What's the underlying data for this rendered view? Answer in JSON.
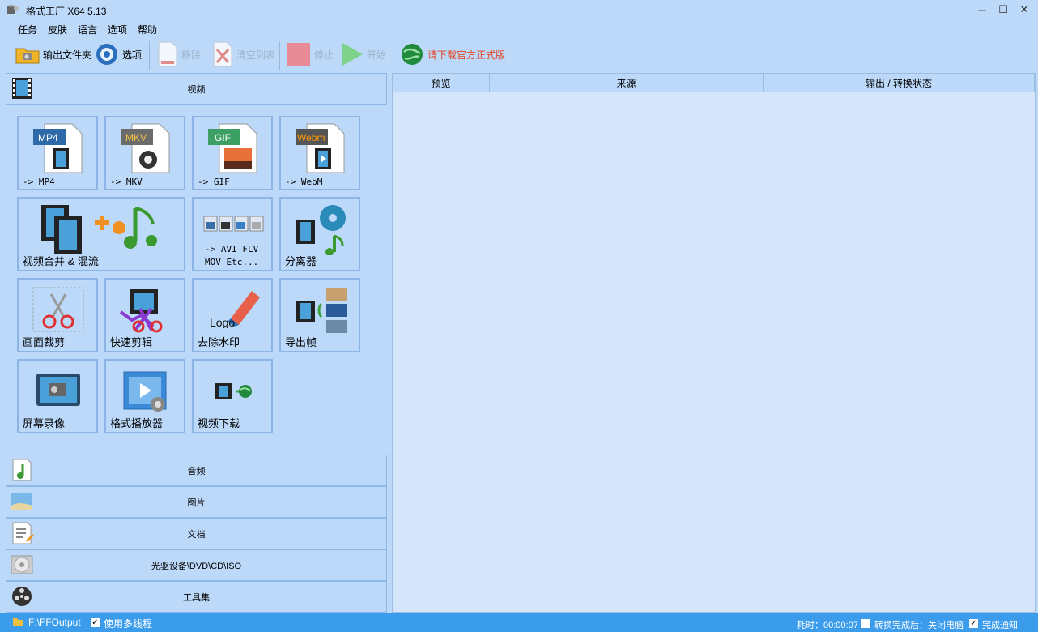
{
  "window": {
    "title": "格式工厂 X64 5.13",
    "minimize": "─",
    "maximize": "☐",
    "close": "✕"
  },
  "menu": {
    "items": [
      "任务",
      "皮肤",
      "语言",
      "选项",
      "帮助"
    ]
  },
  "toolbar": {
    "output_folder": "输出文件夹",
    "options": "选项",
    "remove": "移除",
    "clear_list": "清空列表",
    "stop": "停止",
    "start": "开始",
    "download": "请下载官方正式版"
  },
  "categories": {
    "video": "视频",
    "audio": "音频",
    "image": "图片",
    "document": "文档",
    "optical": "光驱设备\\DVD\\CD\\ISO",
    "tools": "工具集"
  },
  "tiles": {
    "mp4": {
      "badge": "MP4",
      "label": "-> MP4"
    },
    "mkv": {
      "badge": "MKV",
      "label": "-> MKV"
    },
    "gif": {
      "badge": "GIF",
      "label": "-> GIF"
    },
    "webm": {
      "badge": "Webm",
      "label": "-> WebM"
    },
    "merge": {
      "label": "视频合并 & 混流"
    },
    "avi": {
      "label1": "-> AVI FLV",
      "label2": "MOV Etc..."
    },
    "splitter": {
      "label": "分离器"
    },
    "crop": {
      "label": "画面裁剪"
    },
    "quick_clip": {
      "label": "快速剪辑"
    },
    "watermark": {
      "label": "去除水印",
      "logo_text": "Logo"
    },
    "export_frames": {
      "label": "导出帧"
    },
    "screen_record": {
      "label": "屏幕录像"
    },
    "player": {
      "label": "格式播放器"
    },
    "downloader": {
      "label": "视频下载"
    }
  },
  "table": {
    "columns": [
      "预览",
      "来源",
      "输出 / 转换状态"
    ]
  },
  "status": {
    "output_path": "F:\\FFOutput",
    "multithread": "使用多线程",
    "elapsed": "耗时：00:00:07",
    "after_done": "转换完成后：关闭电脑",
    "notify": "完成通知",
    "check": "✓"
  },
  "colors": {
    "accent": "#3b9cec",
    "download_text": "#e8401c",
    "mp4_badge": "#2f6aa8",
    "mkv_badge": "#6b6b6b",
    "gif_badge": "#3ca065",
    "webm_badge": "#ff9a00"
  }
}
